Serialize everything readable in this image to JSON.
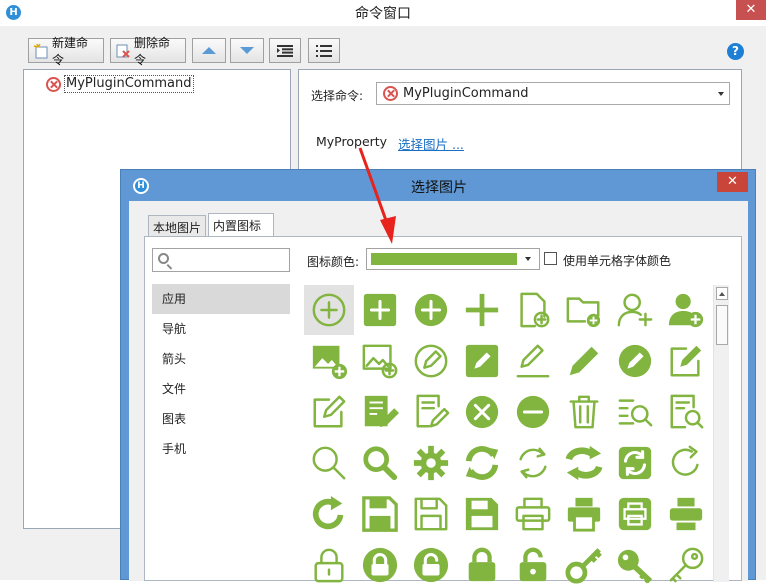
{
  "main_window": {
    "title": "命令窗口",
    "close_glyph": "✕",
    "logo_glyph": "H",
    "help_glyph": "?"
  },
  "toolbar": {
    "new_command_label": "新建命令",
    "delete_command_label": "删除命令"
  },
  "command_list": {
    "items": [
      {
        "label": "MyPluginCommand",
        "status_icon": "error-circle-icon"
      }
    ]
  },
  "properties": {
    "select_command_label": "选择命令:",
    "selected_command": "MyPluginCommand",
    "property_name": "MyProperty",
    "choose_image_link": "选择图片 ..."
  },
  "dialog": {
    "title": "选择图片",
    "close_glyph": "✕",
    "tabs": [
      {
        "label": "本地图片",
        "active": false
      },
      {
        "label": "内置图标",
        "active": true
      }
    ],
    "search_placeholder": "",
    "categories": [
      {
        "label": "应用",
        "selected": true
      },
      {
        "label": "导航",
        "selected": false
      },
      {
        "label": "箭头",
        "selected": false
      },
      {
        "label": "文件",
        "selected": false
      },
      {
        "label": "图表",
        "selected": false
      },
      {
        "label": "手机",
        "selected": false
      }
    ],
    "icon_color_label": "图标颜色:",
    "icon_color": "#82b440",
    "use_cell_font_color_label": "使用单元格字体颜色",
    "use_cell_font_color_checked": false,
    "icons": [
      [
        "add-circle-outline-icon",
        "add-square-icon",
        "add-circle-icon",
        "plus-icon",
        "document-add-icon",
        "folder-add-icon",
        "user-add-outline-icon",
        "user-add-icon"
      ],
      [
        "image-add-icon",
        "image-add-outline-icon",
        "edit-circle-outline-icon",
        "edit-square-icon",
        "pencil-line-icon",
        "pencil-icon",
        "edit-circle-icon",
        "edit-box-icon"
      ],
      [
        "edit-box-outline-icon",
        "document-edit-icon",
        "document-edit-outline-icon",
        "remove-circle-icon",
        "minus-circle-icon",
        "trash-icon",
        "list-search-icon",
        "document-search-icon"
      ],
      [
        "search-outline-icon",
        "search-icon",
        "gear-icon",
        "refresh-icon",
        "refresh-outline-icon",
        "sync-icon",
        "sync-square-icon",
        "redo-icon"
      ],
      [
        "redo-bold-icon",
        "save-icon",
        "save-outline-icon",
        "save-box-icon",
        "printer-outline-icon",
        "printer-icon",
        "printer-square-icon",
        "printer-bold-icon"
      ],
      [
        "lock-outline-icon",
        "lock-circle-icon",
        "lock-open-circle-icon",
        "lock-icon",
        "lock-open-icon",
        "key-icon",
        "key-bold-icon",
        "key-outline-icon"
      ]
    ],
    "selected_icon": "add-circle-outline-icon"
  }
}
